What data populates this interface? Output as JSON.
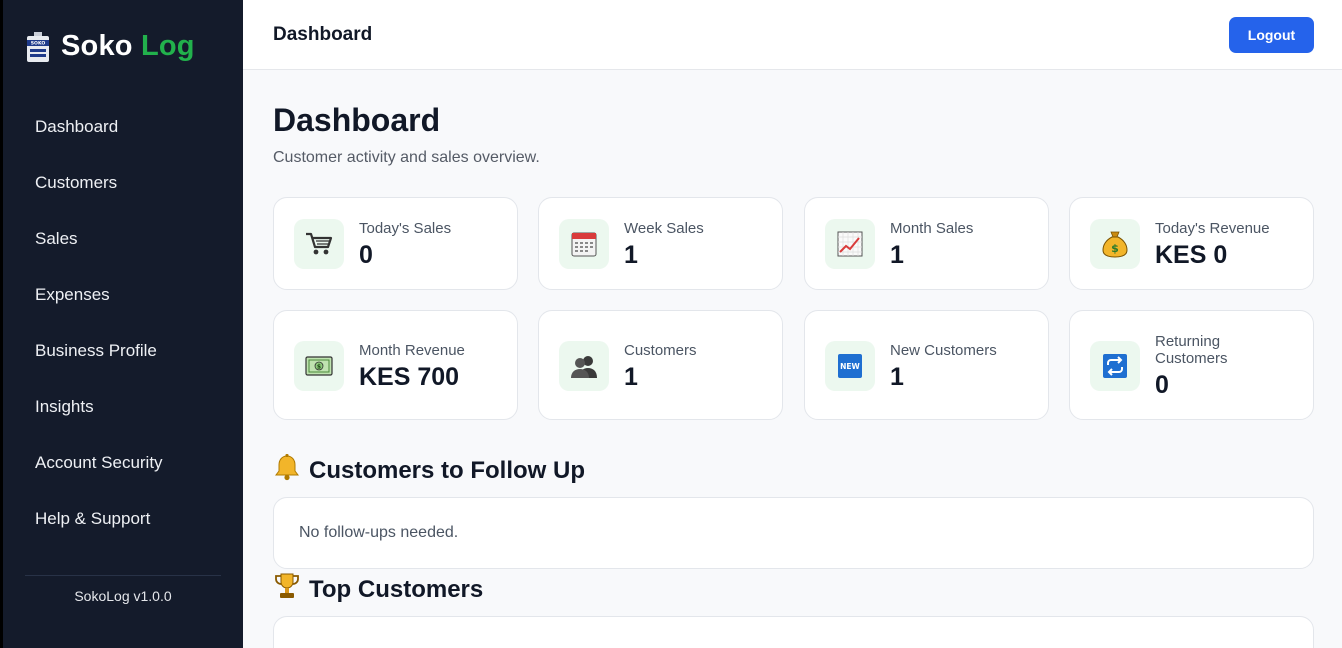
{
  "brand": {
    "word1": "Soko",
    "word2": "Log",
    "logo_icon": "store-sign-icon"
  },
  "sidebar": {
    "items": [
      {
        "label": "Dashboard"
      },
      {
        "label": "Customers"
      },
      {
        "label": "Sales"
      },
      {
        "label": "Expenses"
      },
      {
        "label": "Business Profile"
      },
      {
        "label": "Insights"
      },
      {
        "label": "Account Security"
      },
      {
        "label": "Help & Support"
      }
    ],
    "version": "SokoLog v1.0.0"
  },
  "topbar": {
    "title": "Dashboard",
    "logout_label": "Logout"
  },
  "colors": {
    "sidebar_bg": "#141b2b",
    "brand_accent": "#22b14c",
    "primary": "#2563eb",
    "icon_bg": "#ecf8ef"
  },
  "main": {
    "title": "Dashboard",
    "subtitle": "Customer activity and sales overview.",
    "stats": [
      {
        "label": "Today's Sales",
        "value": "0",
        "icon": "shopping-cart-icon"
      },
      {
        "label": "Week Sales",
        "value": "1",
        "icon": "calendar-icon"
      },
      {
        "label": "Month Sales",
        "value": "1",
        "icon": "chart-increasing-icon"
      },
      {
        "label": "Today's Revenue",
        "value": "KES 0",
        "icon": "money-bag-icon"
      },
      {
        "label": "Month Revenue",
        "value": "KES 700",
        "icon": "banknote-icon"
      },
      {
        "label": "Customers",
        "value": "1",
        "icon": "people-icon"
      },
      {
        "label": "New Customers",
        "value": "1",
        "icon": "new-badge-icon"
      },
      {
        "label": "Returning Customers",
        "value": "0",
        "icon": "repeat-icon"
      }
    ],
    "followup": {
      "title": "Customers to Follow Up",
      "icon": "bell-icon",
      "empty_text": "No follow-ups needed."
    },
    "top_customers": {
      "title": "Top Customers",
      "icon": "trophy-icon"
    }
  }
}
